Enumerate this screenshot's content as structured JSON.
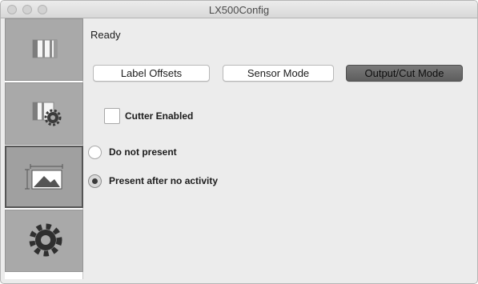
{
  "window": {
    "title": "LX500Config"
  },
  "sidebar": {
    "items": [
      {
        "icon": "label-stock-icon",
        "selected": false
      },
      {
        "icon": "label-settings-icon",
        "selected": false
      },
      {
        "icon": "output-image-icon",
        "selected": true
      },
      {
        "icon": "gear-icon",
        "selected": false
      }
    ]
  },
  "main": {
    "status": "Ready",
    "tabs": [
      {
        "label": "Label Offsets",
        "selected": false
      },
      {
        "label": "Sensor Mode",
        "selected": false
      },
      {
        "label": "Output/Cut Mode",
        "selected": true
      }
    ],
    "cutter_checkbox": {
      "label": "Cutter Enabled",
      "checked": false
    },
    "present_options": [
      {
        "label": "Do not present",
        "selected": false
      },
      {
        "label": "Present after no activity",
        "selected": true
      }
    ]
  }
}
